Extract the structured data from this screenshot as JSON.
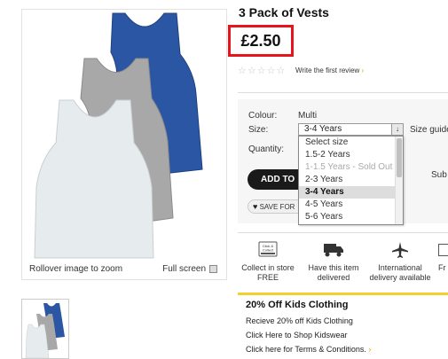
{
  "product": {
    "title": "3 Pack of Vests",
    "price": "£2.50",
    "stars": "☆☆☆☆☆",
    "review_link": "Write the first review",
    "review_arrow": "›"
  },
  "image_panel": {
    "rollover": "Rollover image to zoom",
    "fullscreen": "Full screen",
    "vest_colors": [
      "#2b56a3",
      "#a8a8a8",
      "#e6ebed"
    ]
  },
  "options": {
    "colour_label": "Colour:",
    "colour_value": "Multi",
    "size_label": "Size:",
    "size_selected": "3-4 Years",
    "size_guide": "Size guide",
    "quantity_label": "Quantity:",
    "size_options": [
      {
        "label": "Select size",
        "state": "normal"
      },
      {
        "label": "1.5-2 Years",
        "state": "normal"
      },
      {
        "label": "1-1.5 Years - Sold Out",
        "state": "disabled"
      },
      {
        "label": "2-3 Years",
        "state": "normal"
      },
      {
        "label": "3-4 Years",
        "state": "selected"
      },
      {
        "label": "4-5 Years",
        "state": "normal"
      },
      {
        "label": "5-6 Years",
        "state": "normal"
      }
    ],
    "add_button": "ADD TO",
    "subscribe_text": "Sub",
    "save_button": "SAVE FOR"
  },
  "services": [
    {
      "icon": "click-collect-icon",
      "icon_text": "Click & Collect",
      "line1": "Collect in store",
      "line2": "FREE"
    },
    {
      "icon": "truck-icon",
      "line1": "Have this item",
      "line2": "delivered"
    },
    {
      "icon": "plane-icon",
      "line1": "International",
      "line2": "delivery available"
    },
    {
      "icon": "partial-icon",
      "line1": "Fr",
      "line2": ""
    }
  ],
  "promo": {
    "title": "20% Off Kids Clothing",
    "line1": "Recieve 20% off Kids Clothing",
    "line2": "Click Here to Shop Kidswear",
    "line3": "Click here for Terms & Conditions.",
    "arrow": "›",
    "accent": "#f2d22a"
  },
  "colors": {
    "price_highlight": "#e8141b",
    "link_arrow": "#e5a300"
  }
}
